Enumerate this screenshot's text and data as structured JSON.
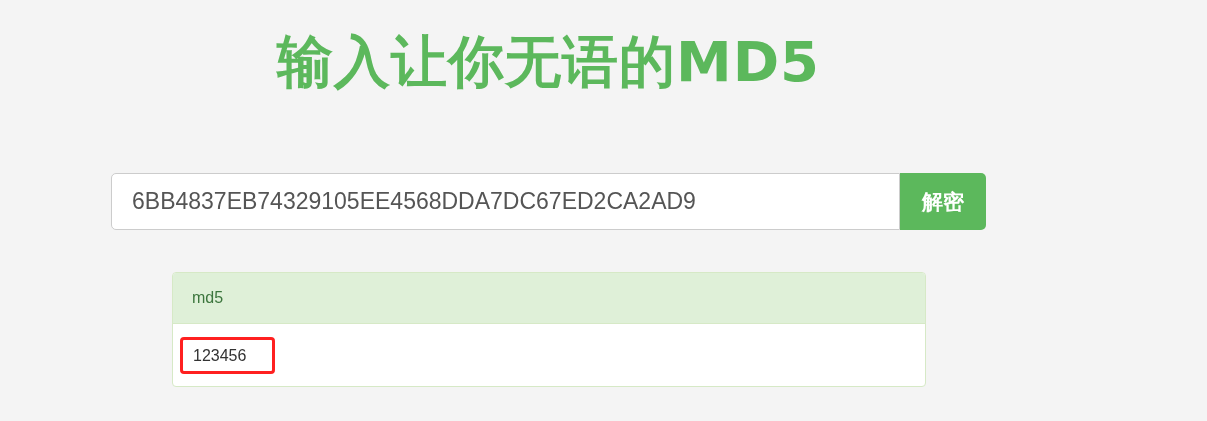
{
  "title": "输入让你无语的MD5",
  "search": {
    "value": "6BB4837EB74329105EE4568DDA7DC67ED2CA2AD9",
    "button": "解密"
  },
  "result": {
    "heading": "md5",
    "value": "123456",
    "highlighted": true
  }
}
